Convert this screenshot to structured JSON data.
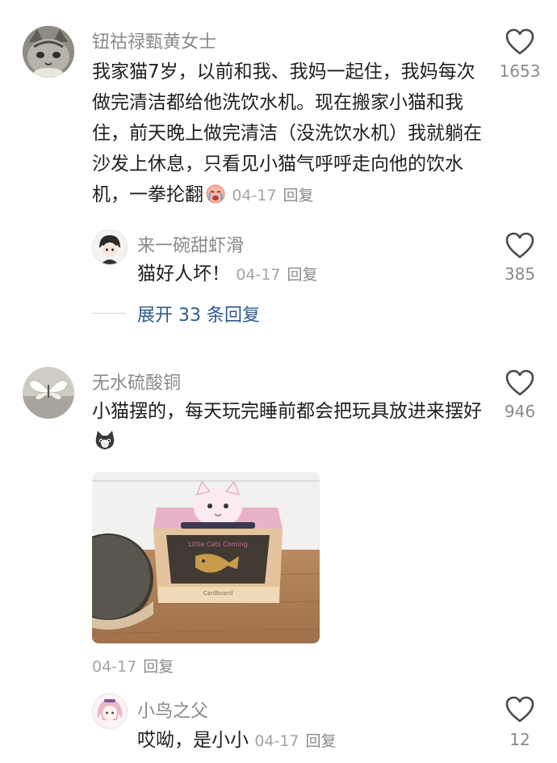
{
  "comments": [
    {
      "username": "钮祜禄甄黄女士",
      "text": "我家猫7岁，以前和我、我妈一起住，我妈每次做完清洁都给他洗饮水机。现在搬家小猫和我住，前天晚上做完清洁（没洗饮水机）我就躺在沙发上休息，只看见小猫气呼呼走向他的饮水机，一拳抡翻",
      "date": "04-17",
      "reply_label": "回复",
      "likes": "1653",
      "reply": {
        "username": "来一碗甜虾滑",
        "text": "猫好人坏！",
        "date": "04-17",
        "reply_label": "回复",
        "likes": "385"
      },
      "expand_label": "展开 33 条回复"
    },
    {
      "username": "无水硫酸铜",
      "text": "小猫摆的，每天玩完睡前都会把玩具放进来摆好",
      "date": "04-17",
      "reply_label": "回复",
      "likes": "946",
      "image_alt_text": "Little Cats Coming",
      "reply": {
        "username": "小鸟之父",
        "text": "哎呦，是小小",
        "date": "04-17",
        "reply_label": "回复",
        "likes": "12"
      }
    }
  ],
  "icons": {
    "like": "heart-outline-icon",
    "emoji_1": "crying-face-emoji",
    "emoji_2": "cat-face-emoji"
  },
  "colors": {
    "name": "#8a8a8a",
    "meta": "#a3a3a3",
    "link": "#2c5a8c",
    "text": "#1f1f1f"
  }
}
